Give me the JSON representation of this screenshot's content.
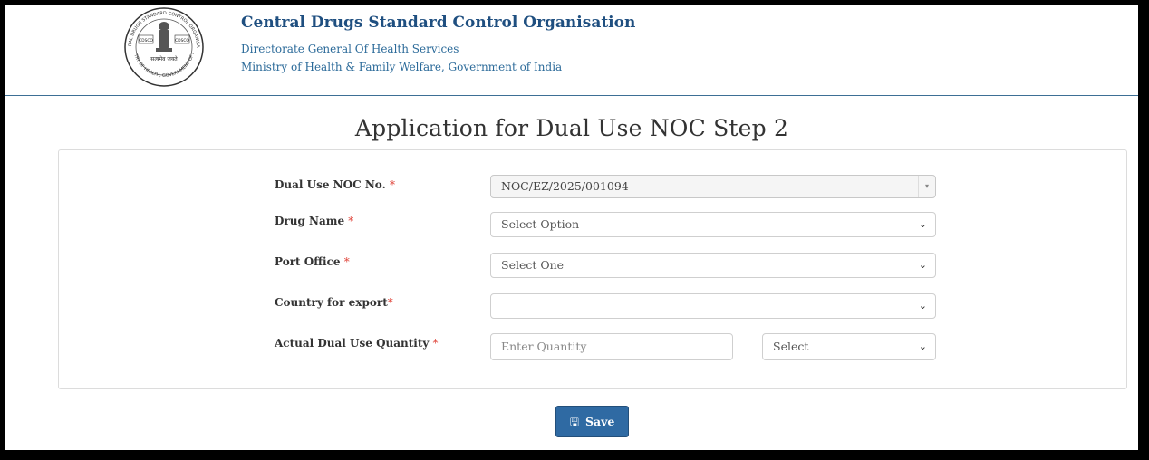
{
  "header": {
    "org_name": "Central Drugs Standard Control Organisation",
    "directorate": "Directorate General Of Health Services",
    "ministry": "Ministry of Health & Family Welfare, Government of India",
    "logo": {
      "ring_text": "CENTRAL DRUGS STANDARD CONTROL ORGANISATION",
      "left_text": "CDSCO",
      "right_text": "CDSCO",
      "motto": "सत्यमेव जयते",
      "bottom_text": "MINISTRY OF HEALTH, GOVERNMENT OF INDIA"
    }
  },
  "page_title": "Application for Dual Use NOC Step 2",
  "form": {
    "required_mark": "*",
    "noc_no": {
      "label": "Dual Use NOC No. ",
      "value": "NOC/EZ/2025/001094",
      "arrow": "▾"
    },
    "drug_name": {
      "label": "Drug Name ",
      "value": "Select Option"
    },
    "port_office": {
      "label": "Port Office ",
      "value": "Select One"
    },
    "country": {
      "label": "Country for export",
      "value": ""
    },
    "quantity": {
      "label": "Actual Dual Use Quantity ",
      "placeholder": "Enter Quantity",
      "unit_value": "Select"
    },
    "chevron": "⌄"
  },
  "save_button": {
    "label": "Save",
    "icon": "floppy-disk-icon",
    "icon_glyph": "🖫"
  },
  "colors": {
    "primary": "#2f6aa3",
    "header_text": "#1f4f80",
    "required": "#e0453b"
  }
}
